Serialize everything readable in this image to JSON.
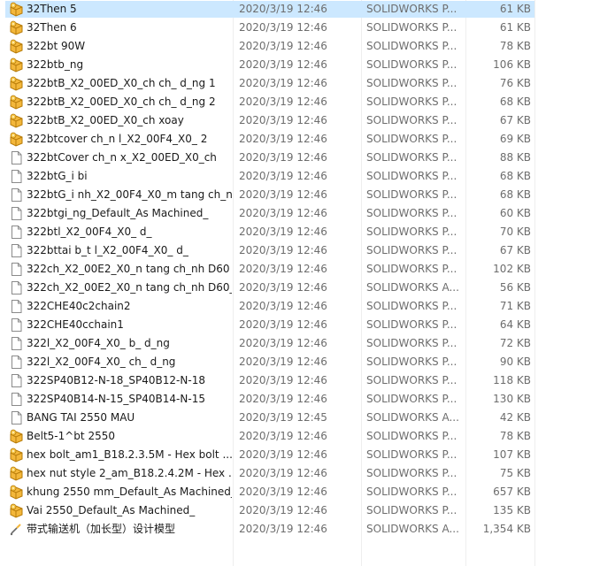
{
  "files": [
    {
      "name": "32Then 5",
      "date": "2020/3/19 12:46",
      "type": "SOLIDWORKS P...",
      "size": "61 KB",
      "icon": "solidworks-part-icon",
      "selected": true
    },
    {
      "name": "32Then 6",
      "date": "2020/3/19 12:46",
      "type": "SOLIDWORKS P...",
      "size": "61 KB",
      "icon": "solidworks-part-icon"
    },
    {
      "name": "322bt 90W",
      "date": "2020/3/19 12:46",
      "type": "SOLIDWORKS P...",
      "size": "78 KB",
      "icon": "solidworks-part-icon"
    },
    {
      "name": "322btb_ng",
      "date": "2020/3/19 12:46",
      "type": "SOLIDWORKS P...",
      "size": "106 KB",
      "icon": "solidworks-part-icon"
    },
    {
      "name": "322btB_X2_00ED_X0_ch ch_ d_ng 1",
      "date": "2020/3/19 12:46",
      "type": "SOLIDWORKS P...",
      "size": "76 KB",
      "icon": "solidworks-part-icon"
    },
    {
      "name": "322btB_X2_00ED_X0_ch ch_ d_ng 2",
      "date": "2020/3/19 12:46",
      "type": "SOLIDWORKS P...",
      "size": "68 KB",
      "icon": "solidworks-part-icon"
    },
    {
      "name": "322btB_X2_00ED_X0_ch xoay",
      "date": "2020/3/19 12:46",
      "type": "SOLIDWORKS P...",
      "size": "67 KB",
      "icon": "solidworks-part-icon"
    },
    {
      "name": "322btcover ch_n l_X2_00F4_X0_ 2",
      "date": "2020/3/19 12:46",
      "type": "SOLIDWORKS P...",
      "size": "69 KB",
      "icon": "solidworks-part-icon"
    },
    {
      "name": "322btCover ch_n x_X2_00ED_X0_ch",
      "date": "2020/3/19 12:46",
      "type": "SOLIDWORKS P...",
      "size": "88 KB",
      "icon": "blank-file-icon"
    },
    {
      "name": "322btG_i bi",
      "date": "2020/3/19 12:46",
      "type": "SOLIDWORKS P...",
      "size": "68 KB",
      "icon": "blank-file-icon"
    },
    {
      "name": "322btG_i nh_X2_00F4_X0_m tang ch_nh",
      "date": "2020/3/19 12:46",
      "type": "SOLIDWORKS P...",
      "size": "68 KB",
      "icon": "blank-file-icon"
    },
    {
      "name": "322btgi_ng_Default_As Machined_",
      "date": "2020/3/19 12:46",
      "type": "SOLIDWORKS P...",
      "size": "60 KB",
      "icon": "blank-file-icon"
    },
    {
      "name": "322btl_X2_00F4_X0_ d_",
      "date": "2020/3/19 12:46",
      "type": "SOLIDWORKS P...",
      "size": "70 KB",
      "icon": "blank-file-icon"
    },
    {
      "name": "322bttai b_t l_X2_00F4_X0_ d_",
      "date": "2020/3/19 12:46",
      "type": "SOLIDWORKS P...",
      "size": "67 KB",
      "icon": "blank-file-icon"
    },
    {
      "name": "322ch_X2_00E2_X0_n tang ch_nh D60",
      "date": "2020/3/19 12:46",
      "type": "SOLIDWORKS P...",
      "size": "102 KB",
      "icon": "blank-file-icon"
    },
    {
      "name": "322ch_X2_00E2_X0_n tang ch_nh D60_1",
      "date": "2020/3/19 12:46",
      "type": "SOLIDWORKS A...",
      "size": "56 KB",
      "icon": "blank-file-icon"
    },
    {
      "name": "322CHE40c2chain2",
      "date": "2020/3/19 12:46",
      "type": "SOLIDWORKS P...",
      "size": "71 KB",
      "icon": "blank-file-icon"
    },
    {
      "name": "322CHE40cchain1",
      "date": "2020/3/19 12:46",
      "type": "SOLIDWORKS P...",
      "size": "64 KB",
      "icon": "blank-file-icon"
    },
    {
      "name": "322l_X2_00F4_X0_ b_ d_ng",
      "date": "2020/3/19 12:46",
      "type": "SOLIDWORKS P...",
      "size": "72 KB",
      "icon": "blank-file-icon"
    },
    {
      "name": "322l_X2_00F4_X0_ ch_ d_ng",
      "date": "2020/3/19 12:46",
      "type": "SOLIDWORKS P...",
      "size": "90 KB",
      "icon": "blank-file-icon"
    },
    {
      "name": "322SP40B12-N-18_SP40B12-N-18",
      "date": "2020/3/19 12:46",
      "type": "SOLIDWORKS P...",
      "size": "118 KB",
      "icon": "blank-file-icon"
    },
    {
      "name": "322SP40B14-N-15_SP40B14-N-15",
      "date": "2020/3/19 12:46",
      "type": "SOLIDWORKS P...",
      "size": "130 KB",
      "icon": "blank-file-icon"
    },
    {
      "name": "BANG  TAI 2550 MAU",
      "date": "2020/3/19 12:45",
      "type": "SOLIDWORKS A...",
      "size": "42 KB",
      "icon": "blank-file-icon"
    },
    {
      "name": "Belt5-1^bt 2550",
      "date": "2020/3/19 12:46",
      "type": "SOLIDWORKS P...",
      "size": "78 KB",
      "icon": "solidworks-part-icon"
    },
    {
      "name": "hex bolt_am1_B18.2.3.5M - Hex bolt ...",
      "date": "2020/3/19 12:46",
      "type": "SOLIDWORKS P...",
      "size": "107 KB",
      "icon": "solidworks-part-icon"
    },
    {
      "name": "hex nut style 2_am_B18.2.4.2M - Hex ...",
      "date": "2020/3/19 12:46",
      "type": "SOLIDWORKS P...",
      "size": "75 KB",
      "icon": "solidworks-part-icon"
    },
    {
      "name": "khung 2550 mm_Default_As Machined_",
      "date": "2020/3/19 12:46",
      "type": "SOLIDWORKS P...",
      "size": "657 KB",
      "icon": "solidworks-part-icon"
    },
    {
      "name": "Vai 2550_Default_As Machined_",
      "date": "2020/3/19 12:46",
      "type": "SOLIDWORKS P...",
      "size": "135 KB",
      "icon": "solidworks-part-icon"
    },
    {
      "name": "带式输送机（加长型）设计模型",
      "date": "2020/3/19 12:46",
      "type": "SOLIDWORKS A...",
      "size": "1,354 KB",
      "icon": "solidworks-assembly-icon"
    }
  ],
  "colors": {
    "selection": "#cce8ff",
    "part_icon": "#e8a317",
    "text": "#1a1a1a",
    "meta": "#6d6d6d"
  }
}
